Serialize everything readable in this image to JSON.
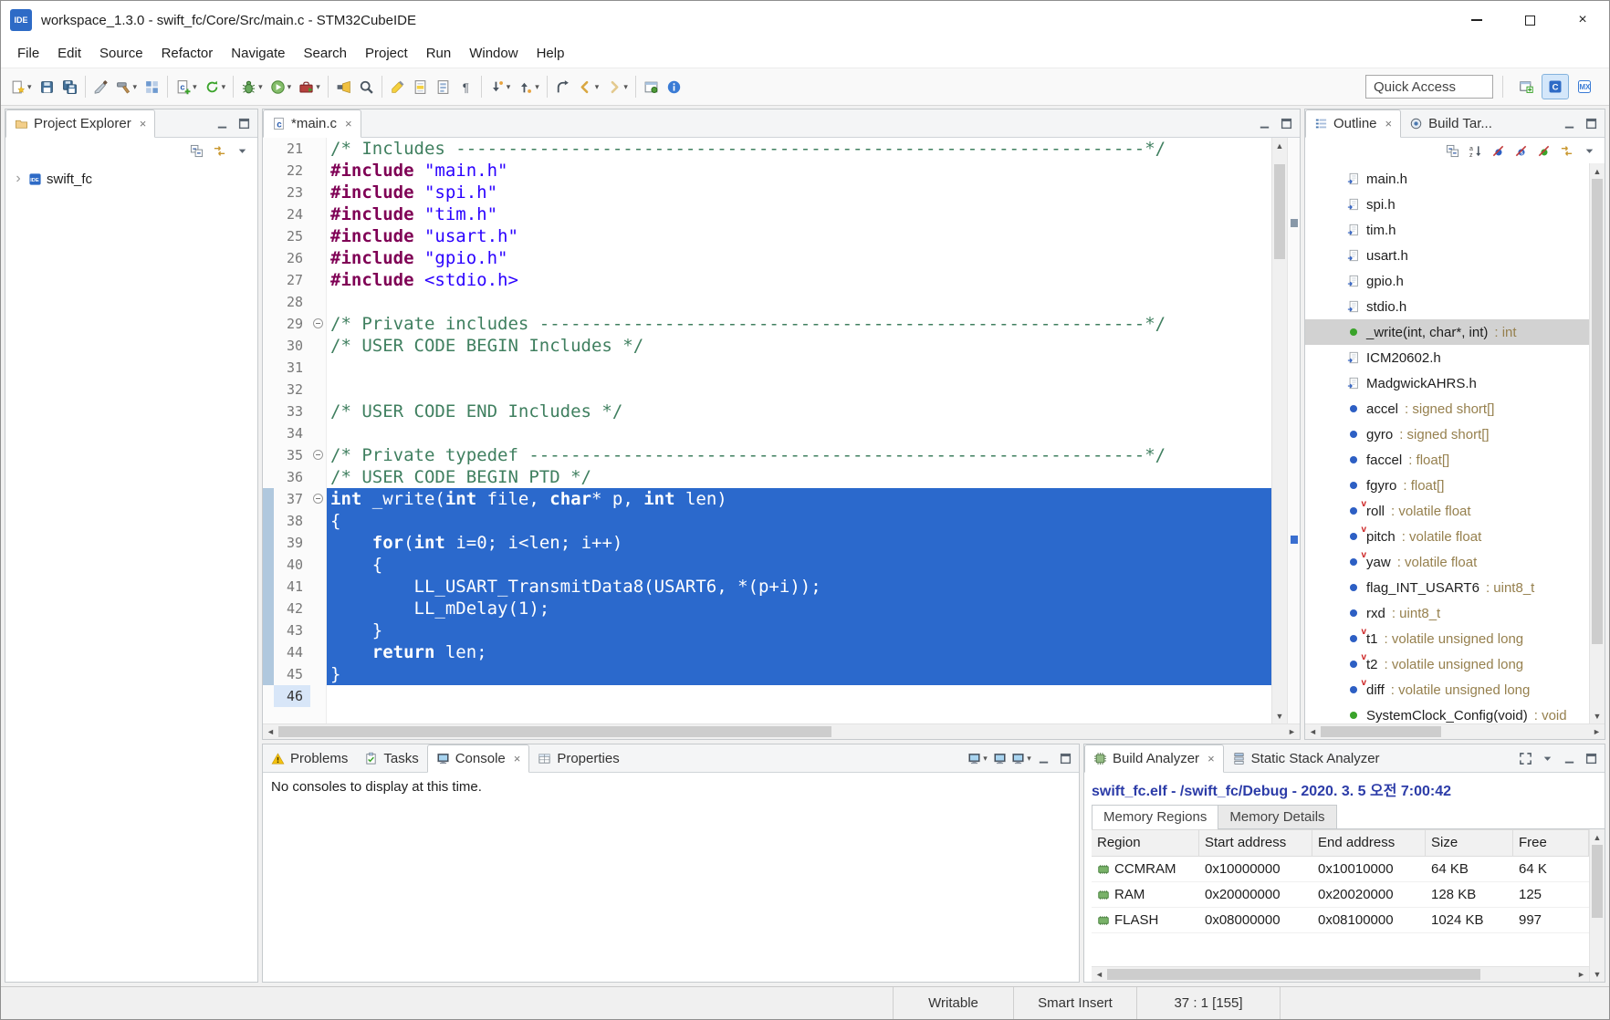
{
  "colors": {
    "selection": "#2b69cc",
    "comment": "#3f7f5f",
    "keyword": "#7f0055",
    "string": "#2a00ff",
    "decoration": "#96804e",
    "analyzer_title": "#2c3ca8"
  },
  "window": {
    "app_icon_text": "IDE",
    "title": "workspace_1.3.0 - swift_fc/Core/Src/main.c - STM32CubeIDE"
  },
  "menu": {
    "items": [
      "File",
      "Edit",
      "Source",
      "Refactor",
      "Navigate",
      "Search",
      "Project",
      "Run",
      "Window",
      "Help"
    ]
  },
  "toolbar": {
    "quick_access": "Quick Access",
    "items": [
      {
        "icon": "new-wizard",
        "dd": true
      },
      {
        "icon": "save"
      },
      {
        "icon": "save-all"
      },
      {
        "sep": true
      },
      {
        "icon": "knife"
      },
      {
        "icon": "hammer",
        "dd": true
      },
      {
        "icon": "binary-grid"
      },
      {
        "sep": true
      },
      {
        "icon": "new-c-file",
        "dd": true
      },
      {
        "icon": "refresh-code",
        "dd": true
      },
      {
        "sep": true
      },
      {
        "icon": "debug",
        "dd": true
      },
      {
        "icon": "run",
        "dd": true
      },
      {
        "icon": "external-tools",
        "dd": true
      },
      {
        "sep": true
      },
      {
        "icon": "flashlight"
      },
      {
        "icon": "search"
      },
      {
        "sep": true
      },
      {
        "icon": "highlighter"
      },
      {
        "icon": "mark-occurrences"
      },
      {
        "icon": "show-blocks"
      },
      {
        "icon": "pilcrow"
      },
      {
        "sep": true
      },
      {
        "icon": "next-annotation",
        "dd": true
      },
      {
        "icon": "prev-annotation",
        "dd": true
      },
      {
        "sep": true
      },
      {
        "icon": "last-edit"
      },
      {
        "icon": "back",
        "dd": true
      },
      {
        "icon": "forward",
        "dd": true
      },
      {
        "sep": true
      },
      {
        "icon": "pin-editor"
      },
      {
        "icon": "info"
      }
    ],
    "perspectives": [
      {
        "icon": "persp-open",
        "name": "open-perspective"
      },
      {
        "icon": "persp-ide",
        "name": "cpp-perspective",
        "active": true
      },
      {
        "icon": "persp-mx",
        "name": "cubemx-perspective"
      }
    ]
  },
  "project_explorer": {
    "tab": "Project Explorer",
    "tab_controls": [
      "min-view",
      "max-view"
    ],
    "toolbar": [
      "collapse-all",
      "link-editor",
      "view-menu"
    ],
    "project": "swift_fc"
  },
  "editor": {
    "tab": "*main.c",
    "tab_controls": [
      "min-view",
      "max-view"
    ],
    "lines": [
      {
        "n": 21,
        "seg": [
          [
            "c",
            "/* Includes ------------------------------------------------------------------*/"
          ]
        ]
      },
      {
        "n": 22,
        "seg": [
          [
            "d",
            "#include "
          ],
          [
            "s",
            "\"main.h\""
          ]
        ]
      },
      {
        "n": 23,
        "seg": [
          [
            "d",
            "#include "
          ],
          [
            "s",
            "\"spi.h\""
          ]
        ]
      },
      {
        "n": 24,
        "seg": [
          [
            "d",
            "#include "
          ],
          [
            "s",
            "\"tim.h\""
          ]
        ]
      },
      {
        "n": 25,
        "seg": [
          [
            "d",
            "#include "
          ],
          [
            "s",
            "\"usart.h\""
          ]
        ]
      },
      {
        "n": 26,
        "seg": [
          [
            "d",
            "#include "
          ],
          [
            "s",
            "\"gpio.h\""
          ]
        ]
      },
      {
        "n": 27,
        "seg": [
          [
            "d",
            "#include "
          ],
          [
            "s",
            "<stdio.h>"
          ]
        ]
      },
      {
        "n": 28,
        "seg": []
      },
      {
        "n": 29,
        "fold": true,
        "seg": [
          [
            "c",
            "/* Private includes ----------------------------------------------------------*/"
          ]
        ]
      },
      {
        "n": 30,
        "seg": [
          [
            "c",
            "/* USER CODE BEGIN Includes */"
          ]
        ]
      },
      {
        "n": 31,
        "seg": []
      },
      {
        "n": 32,
        "seg": []
      },
      {
        "n": 33,
        "seg": [
          [
            "c",
            "/* USER CODE END Includes */"
          ]
        ]
      },
      {
        "n": 34,
        "seg": []
      },
      {
        "n": 35,
        "fold": true,
        "seg": [
          [
            "c",
            "/* Private typedef -----------------------------------------------------------*/"
          ]
        ]
      },
      {
        "n": 36,
        "seg": [
          [
            "c",
            "/* USER CODE BEGIN PTD */"
          ]
        ]
      },
      {
        "n": 37,
        "fold": true,
        "sel": true,
        "seg": [
          [
            "k",
            "int"
          ],
          [
            "p",
            " _write("
          ],
          [
            "k",
            "int"
          ],
          [
            "p",
            " file, "
          ],
          [
            "k",
            "char"
          ],
          [
            "p",
            "* p, "
          ],
          [
            "k",
            "int"
          ],
          [
            "p",
            " len)"
          ]
        ]
      },
      {
        "n": 38,
        "sel": true,
        "seg": [
          [
            "p",
            "{"
          ]
        ]
      },
      {
        "n": 39,
        "sel": true,
        "seg": [
          [
            "p",
            "    "
          ],
          [
            "k",
            "for"
          ],
          [
            "p",
            "("
          ],
          [
            "k",
            "int"
          ],
          [
            "p",
            " i=0; i<len; i++)"
          ]
        ]
      },
      {
        "n": 40,
        "sel": true,
        "seg": [
          [
            "p",
            "    {"
          ]
        ]
      },
      {
        "n": 41,
        "sel": true,
        "seg": [
          [
            "p",
            "        LL_USART_TransmitData8(USART6, *(p+i));"
          ]
        ]
      },
      {
        "n": 42,
        "sel": true,
        "seg": [
          [
            "p",
            "        LL_mDelay(1);"
          ]
        ]
      },
      {
        "n": 43,
        "sel": true,
        "seg": [
          [
            "p",
            "    }"
          ]
        ]
      },
      {
        "n": 44,
        "sel": true,
        "seg": [
          [
            "p",
            "    "
          ],
          [
            "k",
            "return"
          ],
          [
            "p",
            " len;"
          ]
        ]
      },
      {
        "n": 45,
        "sel": true,
        "seg": [
          [
            "p",
            "}"
          ]
        ]
      },
      {
        "n": 46,
        "current": true,
        "seg": []
      }
    ]
  },
  "outline": {
    "tab": "Outline",
    "tab2": "Build Tar...",
    "tab_controls": [
      "min-view",
      "max-view"
    ],
    "toolbar": [
      "collapse-all",
      "sort-az",
      "hide-fields",
      "hide-static",
      "hide-non-public",
      "link-editor",
      "view-menu"
    ],
    "items": [
      {
        "icon": "include",
        "label": "main.h"
      },
      {
        "icon": "include",
        "label": "spi.h"
      },
      {
        "icon": "include",
        "label": "tim.h"
      },
      {
        "icon": "include",
        "label": "usart.h"
      },
      {
        "icon": "include",
        "label": "gpio.h"
      },
      {
        "icon": "include",
        "label": "stdio.h"
      },
      {
        "icon": "method",
        "label": "_write(int, char*, int)",
        "type": "int",
        "selected": true
      },
      {
        "icon": "include",
        "label": "ICM20602.h"
      },
      {
        "icon": "include",
        "label": "MadgwickAHRS.h"
      },
      {
        "icon": "variable",
        "label": "accel",
        "type": "signed short[]"
      },
      {
        "icon": "variable",
        "label": "gyro",
        "type": "signed short[]"
      },
      {
        "icon": "variable",
        "label": "faccel",
        "type": "float[]"
      },
      {
        "icon": "variable",
        "label": "fgyro",
        "type": "float[]"
      },
      {
        "icon": "variable",
        "volatile": true,
        "label": "roll",
        "type": "volatile float"
      },
      {
        "icon": "variable",
        "volatile": true,
        "label": "pitch",
        "type": "volatile float"
      },
      {
        "icon": "variable",
        "volatile": true,
        "label": "yaw",
        "type": "volatile float"
      },
      {
        "icon": "variable",
        "label": "flag_INT_USART6",
        "type": "uint8_t"
      },
      {
        "icon": "variable",
        "label": "rxd",
        "type": "uint8_t"
      },
      {
        "icon": "variable",
        "volatile": true,
        "label": "t1",
        "type": "volatile unsigned long"
      },
      {
        "icon": "variable",
        "volatile": true,
        "label": "t2",
        "type": "volatile unsigned long"
      },
      {
        "icon": "variable",
        "volatile": true,
        "label": "diff",
        "type": "volatile unsigned long"
      },
      {
        "icon": "method",
        "label": "SystemClock_Config(void)",
        "type": "void"
      }
    ]
  },
  "console": {
    "tabs": [
      {
        "icon": "problems",
        "label": "Problems"
      },
      {
        "icon": "tasks",
        "label": "Tasks"
      },
      {
        "icon": "console-tab",
        "label": "Console",
        "active": true
      },
      {
        "icon": "properties",
        "label": "Properties"
      }
    ],
    "toolbar": [
      {
        "icon": "console-tab",
        "name": "open-console",
        "dd": true
      },
      {
        "icon": "console-tab",
        "name": "display-selected-console"
      },
      {
        "icon": "console-tab",
        "name": "open-console-view",
        "dd": true
      },
      {
        "icon": "min-view",
        "name": "minimize-view"
      },
      {
        "icon": "max-view",
        "name": "maximize-view"
      }
    ],
    "message": "No consoles to display at this time."
  },
  "build_analyzer": {
    "tab": "Build Analyzer",
    "tab2": "Static Stack Analyzer",
    "toolbar": [
      {
        "icon": "expand",
        "name": "toggle-layout"
      },
      {
        "icon": "view-menu",
        "name": "view-menu"
      },
      {
        "icon": "min-view",
        "name": "minimize-view"
      },
      {
        "icon": "max-view",
        "name": "maximize-view"
      }
    ],
    "title": "swift_fc.elf - /swift_fc/Debug - 2020. 3. 5 오전 7:00:42",
    "subtabs": [
      {
        "label": "Memory Regions",
        "active": true
      },
      {
        "label": "Memory Details"
      }
    ],
    "columns": [
      "Region",
      "Start address",
      "End address",
      "Size",
      "Free"
    ],
    "rows": [
      {
        "region": "CCMRAM",
        "start": "0x10000000",
        "end": "0x10010000",
        "size": "64 KB",
        "free": "64 K"
      },
      {
        "region": "RAM",
        "start": "0x20000000",
        "end": "0x20020000",
        "size": "128 KB",
        "free": "125"
      },
      {
        "region": "FLASH",
        "start": "0x08000000",
        "end": "0x08100000",
        "size": "1024 KB",
        "free": "997"
      }
    ]
  },
  "status": {
    "writable": "Writable",
    "insert_mode": "Smart Insert",
    "position": "37 : 1 [155]"
  }
}
